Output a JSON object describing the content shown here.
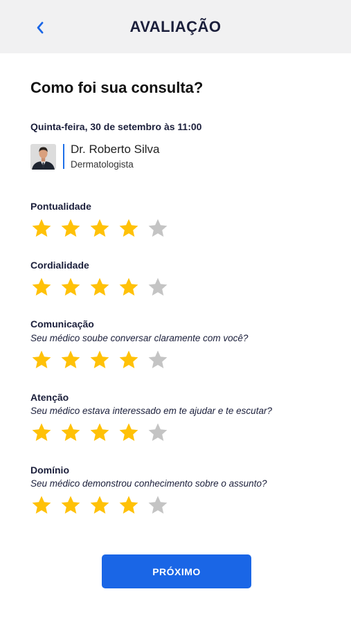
{
  "header": {
    "title": "AVALIAÇÃO",
    "back_icon": "chevron-left-icon"
  },
  "question": "Como foi sua consulta?",
  "appointment": {
    "date": "Quinta-feira, 30 de setembro às 11:00"
  },
  "doctor": {
    "name": "Dr. Roberto Silva",
    "specialty": "Dermatologista"
  },
  "colors": {
    "star_filled": "#FFC107",
    "star_empty": "#C4C4C4",
    "accent": "#1A66E6"
  },
  "ratings": [
    {
      "title": "Pontualidade",
      "subtitle": "",
      "value": 4,
      "max": 5
    },
    {
      "title": "Cordialidade",
      "subtitle": "",
      "value": 4,
      "max": 5
    },
    {
      "title": "Comunicação",
      "subtitle": "Seu médico soube conversar claramente com você?",
      "value": 4,
      "max": 5
    },
    {
      "title": "Atenção",
      "subtitle": "Seu médico estava interessado em te ajudar e te escutar?",
      "value": 4,
      "max": 5
    },
    {
      "title": "Domínio",
      "subtitle": "Seu médico demonstrou conhecimento sobre o assunto?",
      "value": 4,
      "max": 5
    }
  ],
  "next_button": {
    "label": "PRÓXIMO"
  }
}
